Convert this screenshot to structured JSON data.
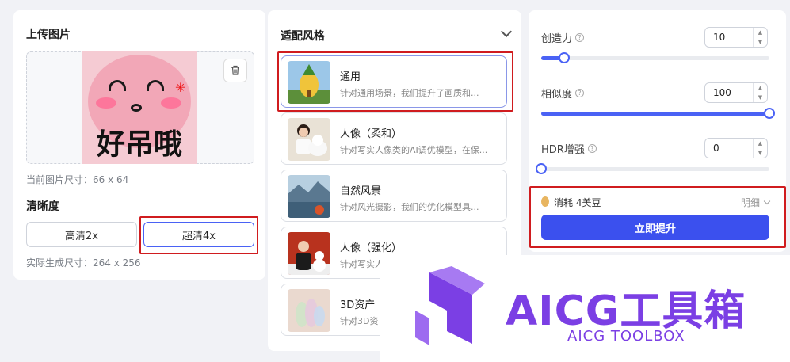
{
  "upload": {
    "title": "上传图片",
    "image_text": "好吊哦",
    "current_size": "当前图片尺寸：66 x 64",
    "clarity_title": "清晰度",
    "options": [
      "高清2x",
      "超清4x"
    ],
    "selected": "超清4x",
    "output_size": "实际生成尺寸：264 x 256",
    "trash_icon": "trash-icon"
  },
  "style": {
    "title": "适配风格",
    "items": [
      {
        "name": "通用",
        "desc": "针对通用场景，我们提升了画质和...",
        "active": true
      },
      {
        "name": "人像（柔和）",
        "desc": "针对写实人像类的AI调优模型，在保...",
        "active": false
      },
      {
        "name": "自然风景",
        "desc": "针对风光摄影，我们的优化模型具...",
        "active": false
      },
      {
        "name": "人像（强化）",
        "desc": "针对写实人",
        "active": false
      },
      {
        "name": "3D资产",
        "desc": "针对3D资",
        "active": false
      }
    ]
  },
  "params": {
    "items": [
      {
        "label": "创造力",
        "value": "10",
        "level": 0.1
      },
      {
        "label": "相似度",
        "value": "100",
        "level": 1.0
      },
      {
        "label": "HDR增强",
        "value": "0",
        "level": 0.0
      }
    ],
    "cost": "消耗 4美豆",
    "detail": "明细",
    "submit": "立即提升"
  },
  "watermark": {
    "title": "AICG工具箱",
    "subtitle": "AICG TOOLBOX"
  },
  "colors": {
    "accent": "#3b50ee",
    "highlight_box": "#d01c1f",
    "watermark": "#7b3fe4"
  }
}
